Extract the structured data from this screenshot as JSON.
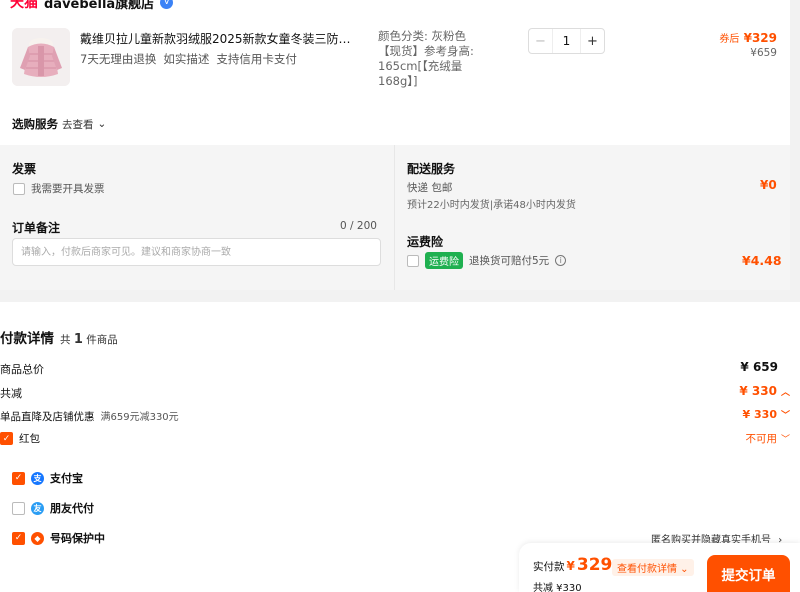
{
  "store": {
    "platform_logo": "天猫",
    "name": "davebella旗舰店",
    "badge": "V"
  },
  "product": {
    "title": "戴维贝拉儿童新款羽绒服2025新款女童冬装三防外套...",
    "tags": [
      "7天无理由退换",
      "如实描述",
      "支持信用卡支付"
    ],
    "spec": "颜色分类: 灰粉色【现货】参考身高: 165cm[【充绒量168g】]",
    "quantity": "1",
    "coupon_label": "券后",
    "coupon_price": "¥329",
    "original_price": "¥659"
  },
  "addon": {
    "label": "选购服务",
    "link": "去查看"
  },
  "invoice": {
    "title": "发票",
    "checkbox_label": "我需要开具发票"
  },
  "remark": {
    "title": "订单备注",
    "count": "0 / 200",
    "placeholder": "请输入，付款后商家可见。建议和商家协商一致"
  },
  "delivery": {
    "title": "配送服务",
    "method": "快递 包邮",
    "eta": "预计22小时内发货|承诺48小时内发货",
    "fee": "¥0"
  },
  "insurance": {
    "title": "运费险",
    "badge": "运费险",
    "desc": "退换货可赔付5元",
    "price": "¥4.48"
  },
  "payment": {
    "title": "付款详情",
    "count_prefix": "共",
    "count": "1",
    "count_suffix": "件商品",
    "rows": [
      {
        "label": "商品总价",
        "value": "¥ 659"
      },
      {
        "label": "共减",
        "value": "¥ 330"
      },
      {
        "label": "单品直降及店铺优惠",
        "note": "满659元减330元",
        "value": "¥ 330"
      },
      {
        "label": "红包",
        "value": "不可用"
      }
    ]
  },
  "methods": [
    {
      "label": "支付宝",
      "checked": true
    },
    {
      "label": "朋友代付",
      "checked": false
    },
    {
      "label": "号码保护中",
      "checked": true
    }
  ],
  "privacy_note": "匿名购买并隐藏真实手机号",
  "bottom": {
    "pay_label": "实付款",
    "currency": "¥",
    "amount": "329",
    "detail": "查看付款详情",
    "saved": "共减 ¥330",
    "submit": "提交订单"
  },
  "colors": {
    "accent": "#ff5000",
    "tmall": "#ff0036",
    "insurance": "#1fb050",
    "alipay": "#1677ff"
  }
}
